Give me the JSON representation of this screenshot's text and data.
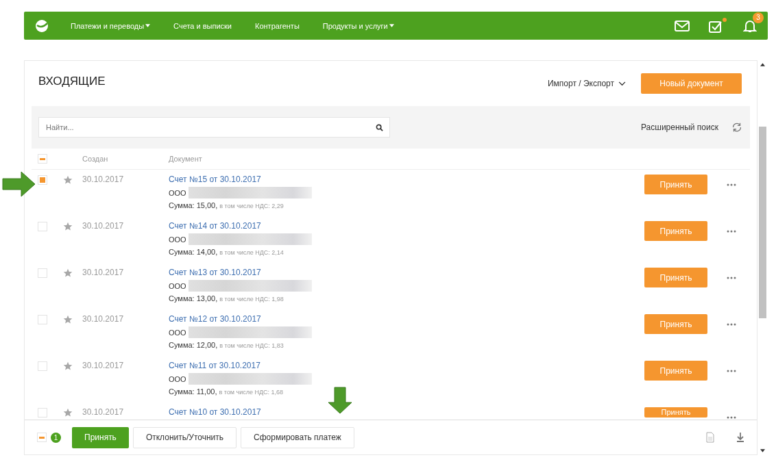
{
  "nav": {
    "items": [
      {
        "label": "Платежи и переводы",
        "dropdown": true
      },
      {
        "label": "Счета и выписки",
        "dropdown": false
      },
      {
        "label": "Контрагенты",
        "dropdown": false
      },
      {
        "label": "Продукты и услуги",
        "dropdown": true
      }
    ],
    "tasks_dot": true,
    "notifications_count": "3"
  },
  "header": {
    "title": "ВХОДЯЩИЕ",
    "import_export": "Импорт / Экспорт",
    "new_button": "Новый документ"
  },
  "search": {
    "placeholder": "Найти...",
    "advanced": "Расширенный поиск"
  },
  "table": {
    "all_partial": true,
    "columns": [
      "Создан",
      "Документ"
    ],
    "rows": [
      {
        "checked": true,
        "date": "30.10.2017",
        "title": "Счет №15 от 30.10.2017",
        "org": "ООО",
        "sum": "Сумма: 15,00,",
        "vat": "в том числе НДС: 2,29",
        "action": "Принять"
      },
      {
        "checked": false,
        "date": "30.10.2017",
        "title": "Счет №14 от 30.10.2017",
        "org": "ООО",
        "sum": "Сумма: 14,00,",
        "vat": "в том числе НДС: 2,14",
        "action": "Принять"
      },
      {
        "checked": false,
        "date": "30.10.2017",
        "title": "Счет №13 от 30.10.2017",
        "org": "ООО",
        "sum": "Сумма: 13,00,",
        "vat": "в том числе НДС: 1,98",
        "action": "Принять"
      },
      {
        "checked": false,
        "date": "30.10.2017",
        "title": "Счет №12 от 30.10.2017",
        "org": "ООО",
        "sum": "Сумма: 12,00,",
        "vat": "в том числе НДС: 1,83",
        "action": "Принять"
      },
      {
        "checked": false,
        "date": "30.10.2017",
        "title": "Счет №11 от 30.10.2017",
        "org": "ООО",
        "sum": "Сумма: 11,00,",
        "vat": "в том числе НДС: 1,68",
        "action": "Принять"
      }
    ],
    "cut_row": {
      "checked": false,
      "date": "30.10.2017",
      "title": "Счет №10 от 30.10.2017",
      "action": "Принять"
    }
  },
  "footer": {
    "partial": true,
    "selected_count": "1",
    "buttons": [
      {
        "label": "Принять",
        "kind": "primary"
      },
      {
        "label": "Отклонить/Уточнить",
        "kind": "plain"
      },
      {
        "label": "Сформировать платеж",
        "kind": "plain"
      }
    ]
  }
}
